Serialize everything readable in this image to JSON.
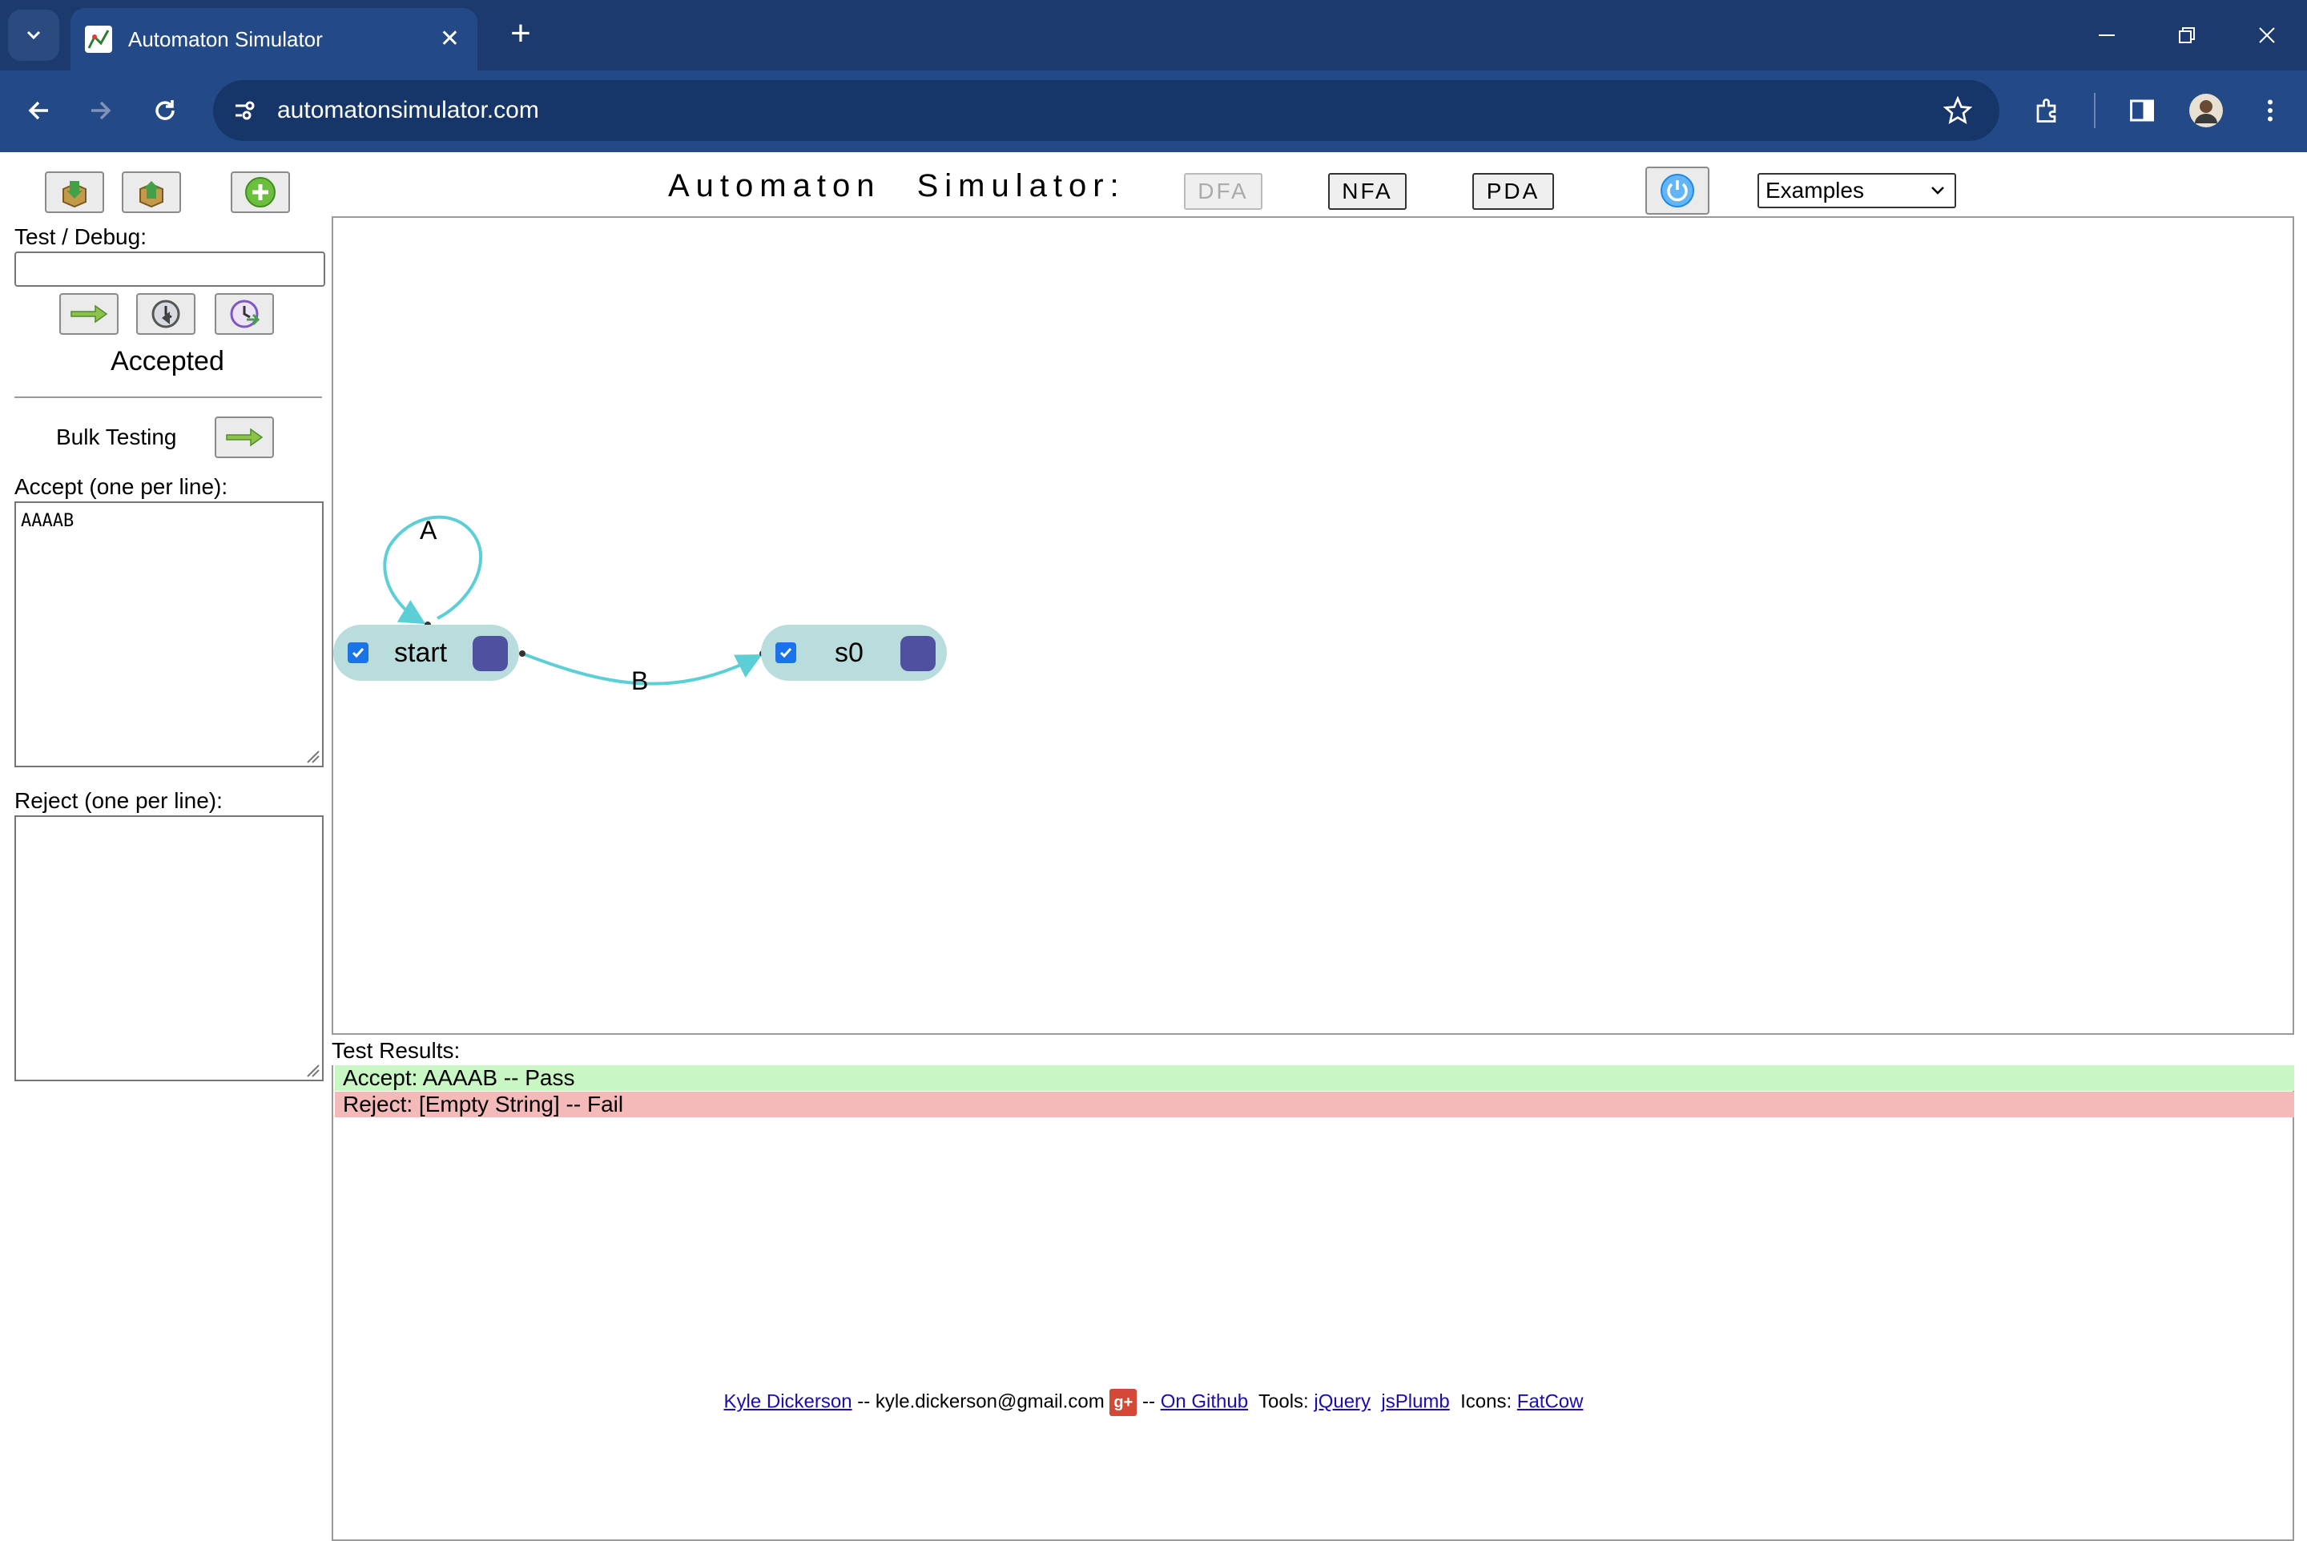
{
  "browser": {
    "tab_title": "Automaton Simulator",
    "url": "automatonsimulator.com"
  },
  "sidebar": {
    "debug_label": "Test / Debug:",
    "debug_value": "",
    "status": "Accepted",
    "bulk_label": "Bulk Testing",
    "accept_label": "Accept (one per line):",
    "accept_value": "AAAAB",
    "reject_label": "Reject (one per line):",
    "reject_value": ""
  },
  "header": {
    "title": "Automaton Simulator:",
    "dfa": "DFA",
    "nfa": "NFA",
    "pda": "PDA",
    "examples": "Examples"
  },
  "diagram": {
    "states": [
      {
        "name": "start",
        "accepting": true
      },
      {
        "name": "s0",
        "accepting": true
      }
    ],
    "transitions": [
      {
        "from": "start",
        "to": "start",
        "label": "A"
      },
      {
        "from": "start",
        "to": "s0",
        "label": "B"
      }
    ]
  },
  "results": {
    "label": "Test Results:",
    "rows": [
      {
        "text": "Accept: AAAAB -- Pass",
        "status": "pass"
      },
      {
        "text": "Reject: [Empty String] -- Fail",
        "status": "fail"
      }
    ]
  },
  "footer": {
    "author": "Kyle Dickerson",
    "sep1": " -- kyle.dickerson@gmail.com ",
    "gplus": "g+",
    "sep2": " -- ",
    "github": "On Github",
    "tools_label": "  Tools: ",
    "jquery": "jQuery",
    "jsplumb": "jsPlumb",
    "icons_label": "  Icons: ",
    "fatcow": "FatCow"
  },
  "colors": {
    "browser_bg": "#1c3a6e",
    "state_fill": "#b9dcdc",
    "state_handle": "#5050a0",
    "transition": "#5ccfd6",
    "pass": "#c9f7c3",
    "fail": "#f4b9b9"
  }
}
